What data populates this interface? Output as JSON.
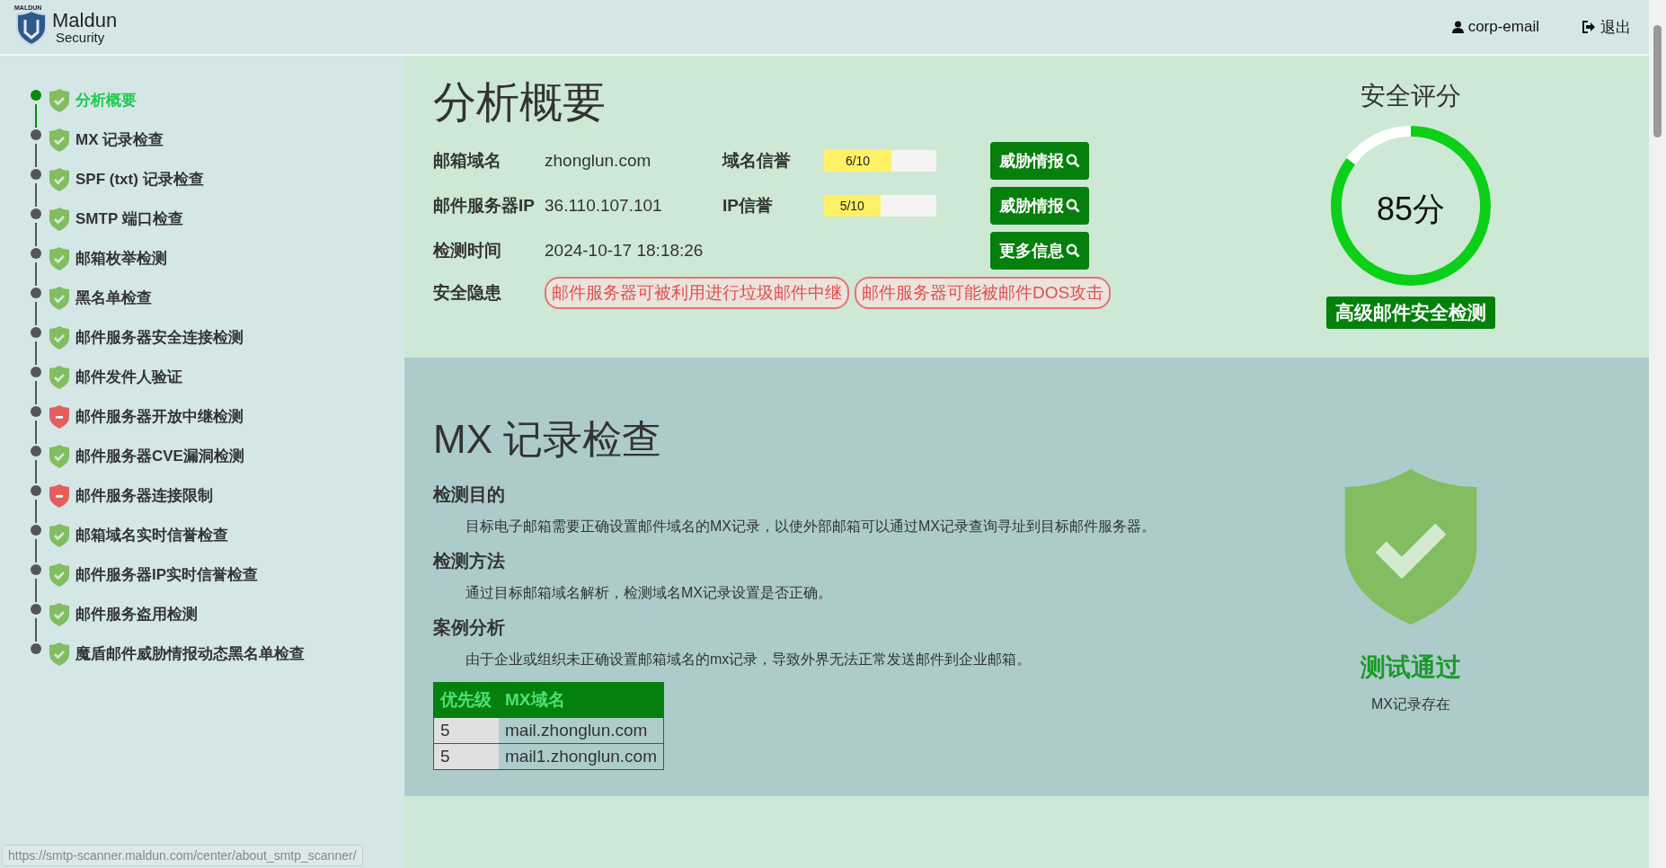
{
  "header": {
    "logo_small": "MALDUN",
    "logo_name": "Maldun",
    "logo_sub": "Security",
    "user": "corp-email",
    "logout": "退出"
  },
  "sidebar": {
    "items": [
      {
        "label": "分析概要",
        "kind": "pass",
        "selected": true
      },
      {
        "label": "MX 记录检查",
        "kind": "pass",
        "selected": false
      },
      {
        "label": "SPF (txt) 记录检查",
        "kind": "pass",
        "selected": false
      },
      {
        "label": "SMTP 端口检查",
        "kind": "pass",
        "selected": false
      },
      {
        "label": "邮箱枚举检测",
        "kind": "pass",
        "selected": false
      },
      {
        "label": "黑名单检查",
        "kind": "pass",
        "selected": false
      },
      {
        "label": "邮件服务器安全连接检测",
        "kind": "pass",
        "selected": false
      },
      {
        "label": "邮件发件人验证",
        "kind": "pass",
        "selected": false
      },
      {
        "label": "邮件服务器开放中继检测",
        "kind": "fail",
        "selected": false
      },
      {
        "label": "邮件服务器CVE漏洞检测",
        "kind": "pass",
        "selected": false
      },
      {
        "label": "邮件服务器连接限制",
        "kind": "fail",
        "selected": false
      },
      {
        "label": "邮箱域名实时信誉检查",
        "kind": "pass",
        "selected": false
      },
      {
        "label": "邮件服务器IP实时信誉检查",
        "kind": "pass",
        "selected": false
      },
      {
        "label": "邮件服务盗用检测",
        "kind": "pass",
        "selected": false
      },
      {
        "label": "魔盾邮件威胁情报动态黑名单检查",
        "kind": "pass",
        "selected": false
      }
    ]
  },
  "summary": {
    "title": "分析概要",
    "domain_label": "邮箱域名",
    "domain": "zhonglun.com",
    "domain_rep_label": "域名信誉",
    "domain_rep": {
      "reading": "6/10",
      "level": 0.6
    },
    "domain_button": "威胁情报",
    "ip_label": "邮件服务器IP",
    "ip": "36.110.107.101",
    "ip_rep_label": "IP信誉",
    "ip_rep": {
      "reading": "5/10",
      "level": 0.5
    },
    "ip_button": "威胁情报",
    "time_label": "检测时间",
    "time": "2024-10-17 18:18:26",
    "more_button": "更多信息",
    "risk_label": "安全隐患",
    "risks": [
      "邮件服务器可被利用进行垃圾邮件中继",
      "邮件服务器可能被邮件DOS攻击"
    ],
    "score_title": "安全评分",
    "score": "85分",
    "score_ring": {
      "level": 0.85
    },
    "advanced_button": "高级邮件安全检测"
  },
  "mx_section": {
    "title": "MX 记录检查",
    "purpose_heading": "检测目的",
    "purpose": "目标电子邮箱需要正确设置邮件域名的MX记录，以使外部邮箱可以通过MX记录查询寻址到目标邮件服务器。",
    "method_heading": "检测方法",
    "method": "通过目标邮箱域名解析，检测域名MX记录设置是否正确。",
    "case_heading": "案例分析",
    "case": "由于企业或组织未正确设置邮箱域名的mx记录，导致外界无法正常发送邮件到企业邮箱。",
    "table": {
      "columns": [
        "优先级",
        "MX域名"
      ],
      "rows": [
        [
          "5",
          "mail.zhonglun.com"
        ],
        [
          "5",
          "mail1.zhonglun.com"
        ]
      ]
    },
    "result": {
      "kind": "pass",
      "text": "测试通过",
      "note": "MX记录存在"
    }
  },
  "status_bar": "https://smtp-scanner.maldun.com/center/about_smtp_scanner/"
}
